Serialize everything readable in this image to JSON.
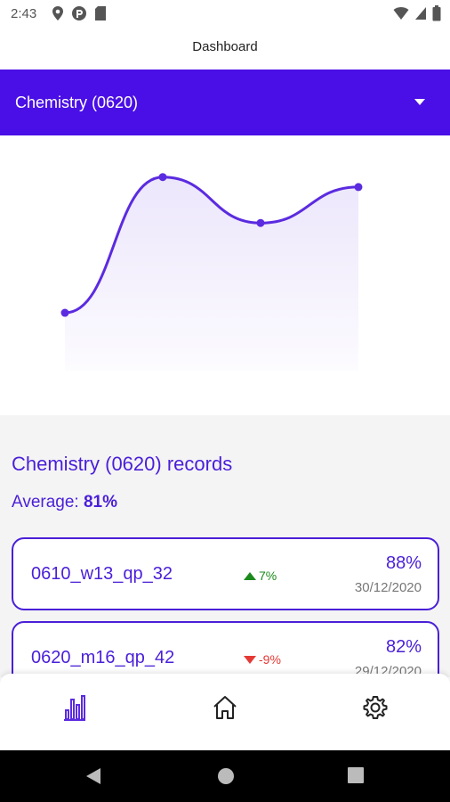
{
  "status_bar": {
    "time": "2:43",
    "left_icons": [
      "location-icon",
      "data-saver-icon",
      "sd-card-icon"
    ],
    "right_icons": [
      "wifi-icon",
      "cell-signal-icon",
      "battery-icon"
    ]
  },
  "app": {
    "title": "Dashboard"
  },
  "subject_selector": {
    "selected": "Chemistry (0620)"
  },
  "chart_data": {
    "type": "line",
    "x": [
      1,
      2,
      3,
      4
    ],
    "values": [
      29,
      97,
      74,
      92
    ],
    "ylim": [
      0,
      100
    ],
    "grid": false,
    "legend": "none",
    "line_color": "#5b2be0",
    "fill_color": "#ece6fb"
  },
  "records": {
    "title": "Chemistry (0620) records",
    "average_label": "Average:",
    "average_value": "81%",
    "items": [
      {
        "name": "0610_w13_qp_32",
        "change": "7%",
        "direction": "up",
        "score": "88%",
        "date": "30/12/2020"
      },
      {
        "name": "0620_m16_qp_42",
        "change": "-9%",
        "direction": "down",
        "score": "82%",
        "date": "29/12/2020"
      }
    ]
  },
  "bottom_nav": {
    "items": [
      {
        "icon": "bar-chart-icon",
        "active": true
      },
      {
        "icon": "home-icon",
        "active": false
      },
      {
        "icon": "settings-gear-icon",
        "active": false
      }
    ]
  },
  "colors": {
    "primary": "#4a0fe6",
    "accent_text": "#4a1fd8",
    "positive": "#1a8a1a",
    "negative": "#e53935"
  }
}
